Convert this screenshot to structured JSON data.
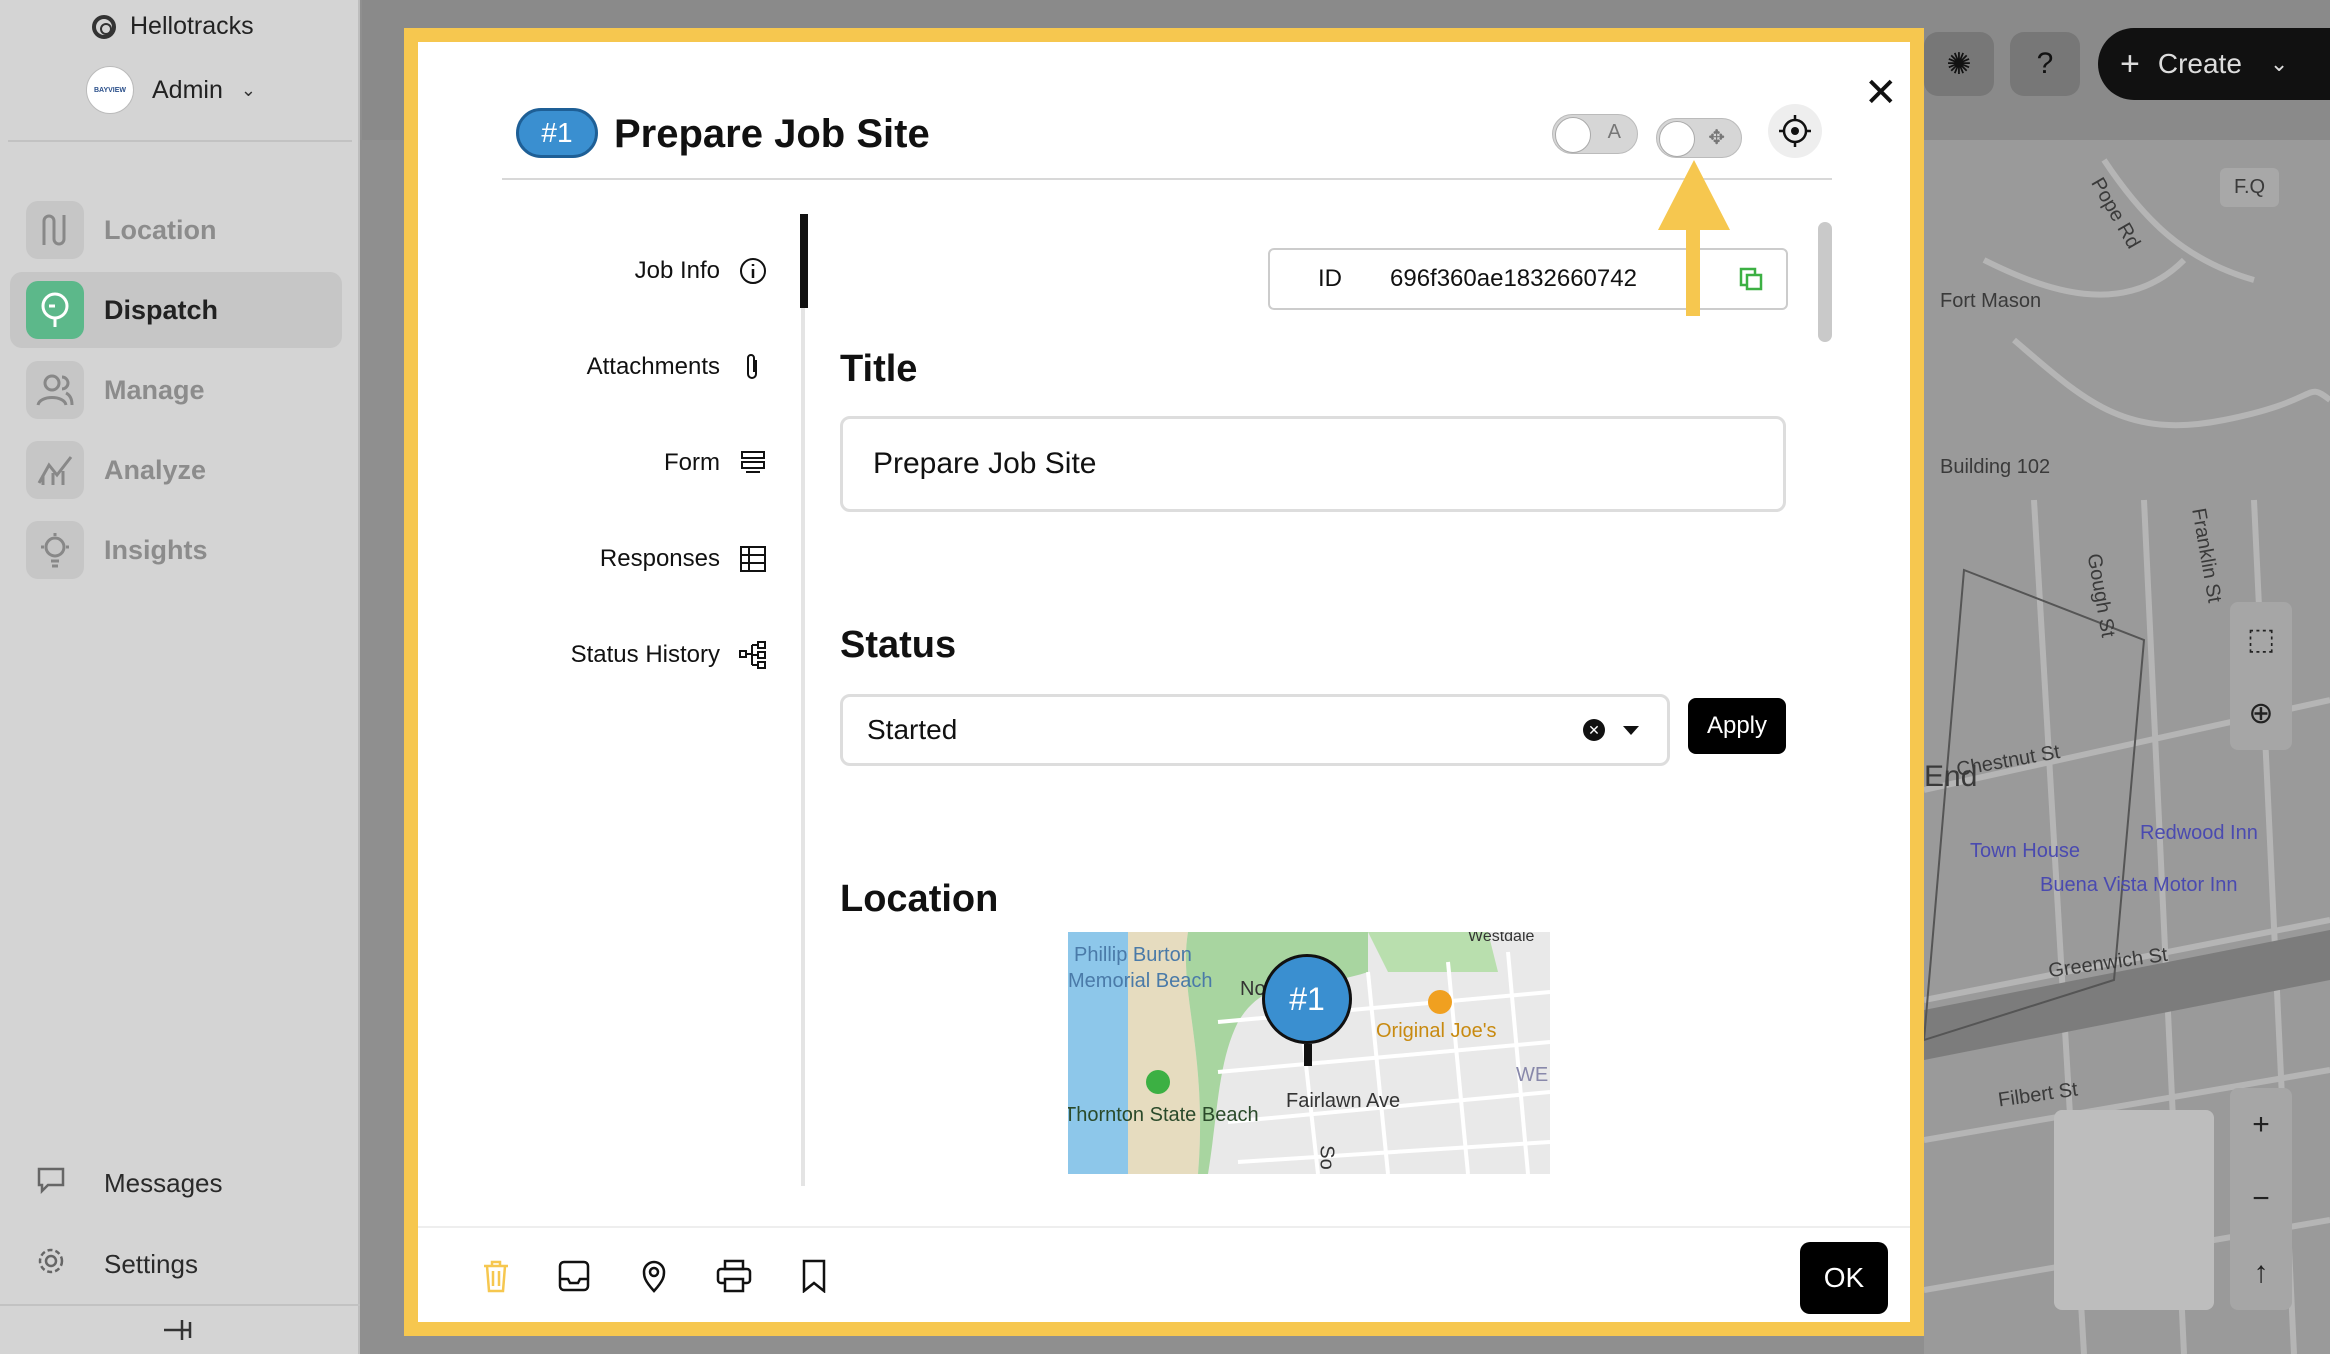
{
  "sidebar": {
    "brand": "Hellotracks",
    "account": "Admin",
    "avatar_text": "BAYVIEW",
    "nav": [
      {
        "label": "Location",
        "icon": "route-icon"
      },
      {
        "label": "Dispatch",
        "icon": "dispatch-icon"
      },
      {
        "label": "Manage",
        "icon": "users-icon"
      },
      {
        "label": "Analyze",
        "icon": "chart-icon"
      },
      {
        "label": "Insights",
        "icon": "bulb-icon"
      }
    ],
    "bottom": [
      {
        "label": "Messages",
        "icon": "chat-icon"
      },
      {
        "label": "Settings",
        "icon": "gear-icon"
      }
    ]
  },
  "topbar": {
    "help": "?",
    "create": "Create"
  },
  "map": {
    "labels": [
      "Fort Mason",
      "Building 102",
      "Chestnut St",
      "End",
      "Town House",
      "Redwood Inn",
      "Buena Vista Motor Inn",
      "Greenwich St",
      "Filbert St",
      "Gough St",
      "Franklin St",
      "Pope Rd",
      "F.Q"
    ]
  },
  "modal": {
    "job_number": "#1",
    "job_title": "Prepare Job Site",
    "tabs": [
      "Job Info",
      "Attachments",
      "Form",
      "Responses",
      "Status History"
    ],
    "id_label": "ID",
    "id_value": "696f360ae1832660742",
    "title_heading": "Title",
    "title_value": "Prepare Job Site",
    "status_heading": "Status",
    "status_value": "Started",
    "apply_label": "Apply",
    "location_heading": "Location",
    "mini_map": {
      "labels": [
        "Phillip Burton",
        "Memorial Beach",
        "Original Joe's",
        "Thornton State Beach",
        "Fairlawn Ave",
        "Westdale",
        "WE",
        "So",
        "No"
      ],
      "pin": "#1"
    },
    "ok_label": "OK"
  },
  "colors": {
    "accent": "#f6c74f",
    "badge": "#3a8fd0",
    "dispatch_active": "#5cb88a"
  }
}
